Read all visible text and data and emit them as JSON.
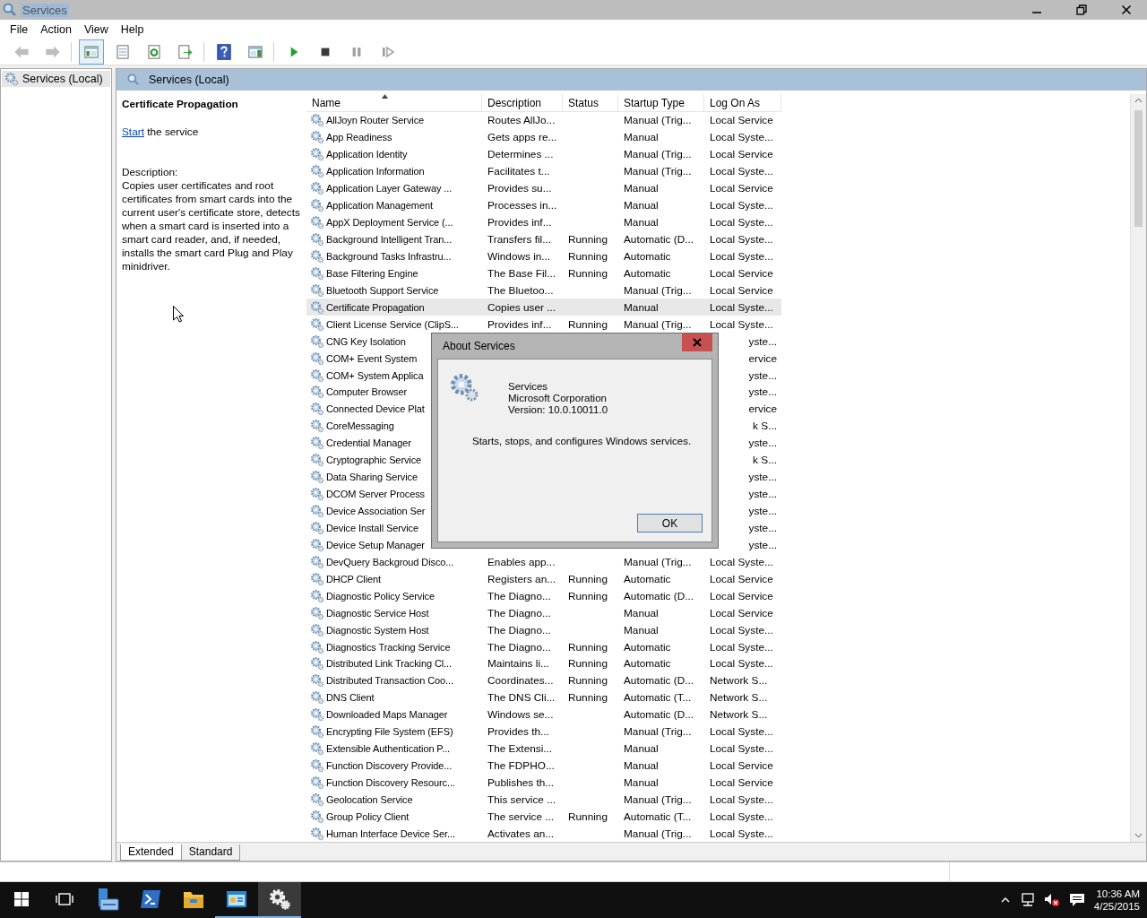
{
  "window": {
    "title": "Services"
  },
  "menu": [
    "File",
    "Action",
    "View",
    "Help"
  ],
  "toolbar": [
    [
      {
        "kind": "back",
        "disabled": true,
        "pressed": false
      },
      {
        "kind": "forward",
        "disabled": true,
        "pressed": false
      }
    ],
    [
      {
        "kind": "console-tree",
        "disabled": false,
        "pressed": true
      },
      {
        "kind": "properties",
        "disabled": false,
        "pressed": false
      },
      {
        "kind": "refresh",
        "disabled": false,
        "pressed": false
      },
      {
        "kind": "export",
        "disabled": false,
        "pressed": false
      }
    ],
    [
      {
        "kind": "help",
        "disabled": false,
        "pressed": false
      },
      {
        "kind": "action-pane",
        "disabled": false,
        "pressed": false
      }
    ],
    [
      {
        "kind": "play",
        "disabled": false,
        "pressed": false
      },
      {
        "kind": "stop",
        "disabled": false,
        "pressed": false
      },
      {
        "kind": "pause",
        "disabled": true,
        "pressed": false
      },
      {
        "kind": "resume",
        "disabled": true,
        "pressed": false
      }
    ]
  ],
  "tree": [
    {
      "label": "Services (Local)",
      "selected": true
    }
  ],
  "header": {
    "title": "Services (Local)"
  },
  "details": {
    "title": "Certificate Propagation",
    "action_link": "Start",
    "action_text": "the service",
    "description_label": "Description:",
    "description": "Copies user certificates and root certificates from smart cards into the current user's certificate store, detects when a smart card is inserted into a smart card reader, and, if needed, installs the smart card Plug and Play minidriver."
  },
  "table": {
    "columns": [
      {
        "label": "Name",
        "sorted": true
      },
      {
        "label": "Description",
        "sorted": false
      },
      {
        "label": "Status",
        "sorted": false
      },
      {
        "label": "Startup Type",
        "sorted": false
      },
      {
        "label": "Log On As",
        "sorted": false
      }
    ],
    "rows": [
      {
        "name": "AllJoyn Router Service",
        "description": "Routes AllJo...",
        "startup_type": "Manual (Trig...",
        "log_on_as": "Local Service",
        "selected": false
      },
      {
        "name": "App Readiness",
        "description": "Gets apps re...",
        "startup_type": "Manual",
        "log_on_as": "Local Syste...",
        "selected": false
      },
      {
        "name": "Application Identity",
        "description": "Determines ...",
        "startup_type": "Manual (Trig...",
        "log_on_as": "Local Service",
        "selected": false
      },
      {
        "name": "Application Information",
        "description": "Facilitates t...",
        "startup_type": "Manual (Trig...",
        "log_on_as": "Local Syste...",
        "selected": false
      },
      {
        "name": "Application Layer Gateway ...",
        "description": "Provides su...",
        "startup_type": "Manual",
        "log_on_as": "Local Service",
        "selected": false
      },
      {
        "name": "Application Management",
        "description": "Processes in...",
        "startup_type": "Manual",
        "log_on_as": "Local Syste...",
        "selected": false
      },
      {
        "name": "AppX Deployment Service (...",
        "description": "Provides inf...",
        "startup_type": "Manual",
        "log_on_as": "Local Syste...",
        "selected": false
      },
      {
        "name": "Background Intelligent Tran...",
        "description": "Transfers fil...",
        "status": "Running",
        "startup_type": "Automatic (D...",
        "log_on_as": "Local Syste...",
        "selected": false
      },
      {
        "name": "Background Tasks Infrastru...",
        "description": "Windows in...",
        "status": "Running",
        "startup_type": "Automatic",
        "log_on_as": "Local Syste...",
        "selected": false
      },
      {
        "name": "Base Filtering Engine",
        "description": "The Base Fil...",
        "status": "Running",
        "startup_type": "Automatic",
        "log_on_as": "Local Service",
        "selected": false
      },
      {
        "name": "Bluetooth Support Service",
        "description": "The Bluetoo...",
        "startup_type": "Manual (Trig...",
        "log_on_as": "Local Service",
        "selected": false
      },
      {
        "name": "Certificate Propagation",
        "description": "Copies user ...",
        "startup_type": "Manual",
        "log_on_as": "Local Syste...",
        "selected": true
      },
      {
        "name": "Client License Service (ClipS...",
        "description": "Provides inf...",
        "status": "Running",
        "startup_type": "Manual (Trig...",
        "log_on_as": "Local Syste...",
        "selected": false
      },
      {
        "name": "CNG Key Isolation",
        "log_on_as": "yste...",
        "selected": false
      },
      {
        "name": "COM+ Event System",
        "log_on_as": "ervice",
        "selected": false
      },
      {
        "name": "COM+ System Applica",
        "log_on_as": "yste...",
        "selected": false
      },
      {
        "name": "Computer Browser",
        "log_on_as": "yste...",
        "selected": false
      },
      {
        "name": "Connected Device Plat",
        "log_on_as": "ervice",
        "selected": false
      },
      {
        "name": "CoreMessaging",
        "log_on_as": "k S...",
        "selected": false
      },
      {
        "name": "Credential Manager",
        "log_on_as": "yste...",
        "selected": false
      },
      {
        "name": "Cryptographic Service",
        "log_on_as": "k S...",
        "selected": false
      },
      {
        "name": "Data Sharing Service",
        "log_on_as": "yste...",
        "selected": false
      },
      {
        "name": "DCOM Server Process",
        "log_on_as": "yste...",
        "selected": false
      },
      {
        "name": "Device Association Ser",
        "log_on_as": "yste...",
        "selected": false
      },
      {
        "name": "Device Install Service",
        "log_on_as": "yste...",
        "selected": false
      },
      {
        "name": "Device Setup Manager",
        "log_on_as": "yste...",
        "selected": false
      },
      {
        "name": "DevQuery Backgroud Disco...",
        "description": "Enables app...",
        "startup_type": "Manual (Trig...",
        "log_on_as": "Local Syste...",
        "selected": false
      },
      {
        "name": "DHCP Client",
        "description": "Registers an...",
        "status": "Running",
        "startup_type": "Automatic",
        "log_on_as": "Local Service",
        "selected": false
      },
      {
        "name": "Diagnostic Policy Service",
        "description": "The Diagno...",
        "status": "Running",
        "startup_type": "Automatic (D...",
        "log_on_as": "Local Service",
        "selected": false
      },
      {
        "name": "Diagnostic Service Host",
        "description": "The Diagno...",
        "startup_type": "Manual",
        "log_on_as": "Local Service",
        "selected": false
      },
      {
        "name": "Diagnostic System Host",
        "description": "The Diagno...",
        "startup_type": "Manual",
        "log_on_as": "Local Syste...",
        "selected": false
      },
      {
        "name": "Diagnostics Tracking Service",
        "description": "The Diagno...",
        "status": "Running",
        "startup_type": "Automatic",
        "log_on_as": "Local Syste...",
        "selected": false
      },
      {
        "name": "Distributed Link Tracking Cl...",
        "description": "Maintains li...",
        "status": "Running",
        "startup_type": "Automatic",
        "log_on_as": "Local Syste...",
        "selected": false
      },
      {
        "name": "Distributed Transaction Coo...",
        "description": "Coordinates...",
        "status": "Running",
        "startup_type": "Automatic (D...",
        "log_on_as": "Network S...",
        "selected": false
      },
      {
        "name": "DNS Client",
        "description": "The DNS Cli...",
        "status": "Running",
        "startup_type": "Automatic (T...",
        "log_on_as": "Network S...",
        "selected": false
      },
      {
        "name": "Downloaded Maps Manager",
        "description": "Windows se...",
        "startup_type": "Automatic (D...",
        "log_on_as": "Network S...",
        "selected": false
      },
      {
        "name": "Encrypting File System (EFS)",
        "description": "Provides th...",
        "startup_type": "Manual (Trig...",
        "log_on_as": "Local Syste...",
        "selected": false
      },
      {
        "name": "Extensible Authentication P...",
        "description": "The Extensi...",
        "startup_type": "Manual",
        "log_on_as": "Local Syste...",
        "selected": false
      },
      {
        "name": "Function Discovery Provide...",
        "description": "The FDPHO...",
        "startup_type": "Manual",
        "log_on_as": "Local Service",
        "selected": false
      },
      {
        "name": "Function Discovery Resourc...",
        "description": "Publishes th...",
        "startup_type": "Manual",
        "log_on_as": "Local Service",
        "selected": false
      },
      {
        "name": "Geolocation Service",
        "description": "This service ...",
        "startup_type": "Manual (Trig...",
        "log_on_as": "Local Syste...",
        "selected": false
      },
      {
        "name": "Group Policy Client",
        "description": "The service ...",
        "status": "Running",
        "startup_type": "Automatic (T...",
        "log_on_as": "Local Syste...",
        "selected": false
      },
      {
        "name": "Human Interface Device Ser...",
        "description": "Activates an...",
        "startup_type": "Manual (Trig...",
        "log_on_as": "Local Syste...",
        "selected": false
      }
    ]
  },
  "tabs": [
    {
      "label": "Extended",
      "selected": true
    },
    {
      "label": "Standard",
      "selected": false
    }
  ],
  "dialog": {
    "title": "About Services",
    "product": "Services",
    "company": "Microsoft Corporation",
    "version": "Version: 10.0.10011.0",
    "summary": "Starts, stops, and configures Windows services.",
    "button": "OK"
  },
  "taskbar": {
    "apps": [
      {
        "kind": "server",
        "running": false,
        "selected": false
      },
      {
        "kind": "terminal",
        "running": false,
        "selected": false
      },
      {
        "kind": "folder",
        "running": false,
        "selected": false
      },
      {
        "kind": "viewer",
        "running": true,
        "selected": false
      },
      {
        "kind": "gears",
        "running": true,
        "selected": true
      }
    ],
    "time": "10:36 AM",
    "date": "4/25/2015"
  }
}
